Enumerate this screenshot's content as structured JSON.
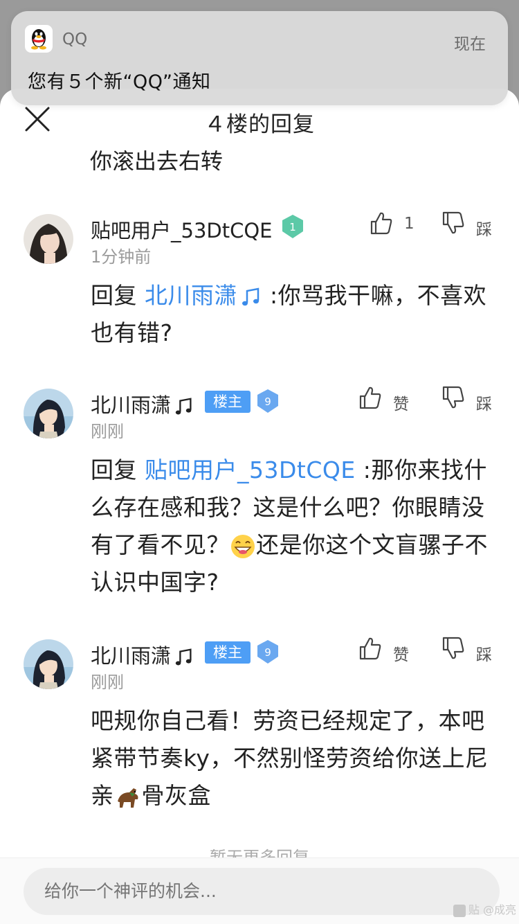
{
  "notification": {
    "app_name": "QQ",
    "time": "现在",
    "message": "您有５个新“QQ”通知",
    "app_icon": "qq-penguin-icon"
  },
  "sheet": {
    "title": "４楼的回复",
    "close_icon": "close-icon",
    "truncated_text": "你滚出去右转"
  },
  "comments": [
    {
      "username": "贴吧用户_53DtCQE",
      "level": "1",
      "level_color": "#5cc9a7",
      "time": "1分钟前",
      "like_count": "1",
      "dislike_label": "踩",
      "body_prefix": "回复 ",
      "mention": "北川雨潇",
      "body_rest": " :你骂我干嘛，不喜欢也有错?"
    },
    {
      "username": "北川雨潇",
      "owner_badge": "楼主",
      "level": "9",
      "level_color": "#6aa8f0",
      "time": "刚刚",
      "like_label": "赞",
      "dislike_label": "踩",
      "body_prefix": "回复 ",
      "mention": "贴吧用户_53DtCQE",
      "body_rest": " :那你来找什么存在感和我？这是什么吧？你眼睛没有了看不见？",
      "body_emoji": "grinning-emoji",
      "body_rest2": "还是你这个文盲骡子不认识中国字?"
    },
    {
      "username": "北川雨潇",
      "owner_badge": "楼主",
      "level": "9",
      "level_color": "#6aa8f0",
      "time": "刚刚",
      "like_label": "赞",
      "dislike_label": "踩",
      "body_part1": "吧规你自己看！劳资已经规定了，本吧紧带节奏ky，不然别怪劳资给你送上尼亲",
      "body_emoji": "horse-emoji",
      "body_part2": "骨灰盒"
    }
  ],
  "footer": {
    "more_replies": "暂无更多回复",
    "input_placeholder": "给你一个神评的机会...",
    "watermark": "贴 @成亮"
  },
  "colors": {
    "mention": "#3a8bea",
    "owner_badge": "#4e9ef5",
    "overlay": "#9a9a9a"
  }
}
